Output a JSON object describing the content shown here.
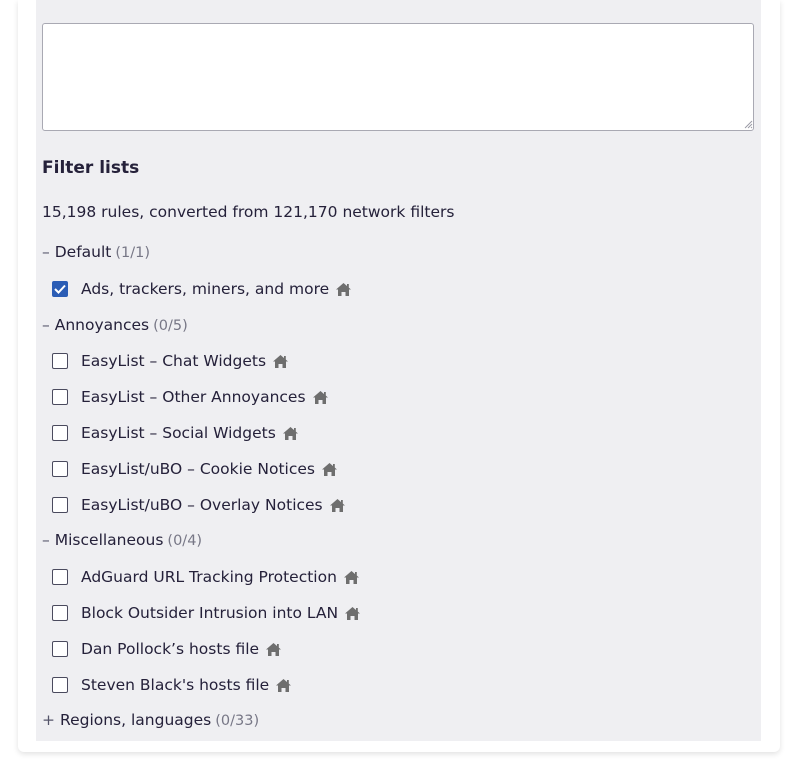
{
  "editor": {
    "value": "",
    "placeholder": ""
  },
  "section_title": "Filter lists",
  "summary": "15,198 rules, converted from 121,170 network filters",
  "groups": [
    {
      "toggle": "–",
      "name": "Default",
      "count": "(1/1)"
    },
    {
      "toggle": "–",
      "name": "Annoyances",
      "count": "(0/5)"
    },
    {
      "toggle": "–",
      "name": "Miscellaneous",
      "count": "(0/4)"
    },
    {
      "toggle": "+",
      "name": "Regions, languages",
      "count": "(0/33)"
    }
  ],
  "lists": [
    {
      "label": "Ads, trackers, miners, and more",
      "checked": true
    },
    {
      "label": "EasyList – Chat Widgets",
      "checked": false
    },
    {
      "label": "EasyList – Other Annoyances",
      "checked": false
    },
    {
      "label": "EasyList – Social Widgets",
      "checked": false
    },
    {
      "label": "EasyList/uBO – Cookie Notices",
      "checked": false
    },
    {
      "label": "EasyList/uBO – Overlay Notices",
      "checked": false
    },
    {
      "label": "AdGuard URL Tracking Protection",
      "checked": false
    },
    {
      "label": "Block Outsider Intrusion into LAN",
      "checked": false
    },
    {
      "label": "Dan Pollock’s hosts file",
      "checked": false
    },
    {
      "label": "Steven Black's hosts file",
      "checked": false
    }
  ],
  "colors": {
    "accent": "#2b5db5",
    "panel": "#efeff2",
    "home_icon": "#6e6e6e"
  },
  "icons": {
    "home": "home-icon",
    "check": "check-icon",
    "resize": "resize-grip-icon"
  }
}
